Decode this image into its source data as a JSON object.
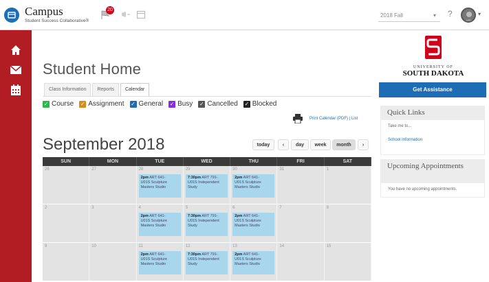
{
  "header": {
    "app_name": "Campus",
    "app_subtitle": "Student Success Collaborative®",
    "notification_count": "20",
    "term": "2018 Fall",
    "help": "?"
  },
  "page": {
    "title": "Student Home",
    "tabs": [
      {
        "label": "Class Information",
        "active": false
      },
      {
        "label": "Reports",
        "active": false
      },
      {
        "label": "Calendar",
        "active": true
      }
    ],
    "legend": [
      {
        "label": "Course",
        "color": "#2eb84b"
      },
      {
        "label": "Assignment",
        "color": "#d98b1a"
      },
      {
        "label": "General",
        "color": "#1d6cb6"
      },
      {
        "label": "Busy",
        "color": "#8a2be2"
      },
      {
        "label": "Cancelled",
        "color": "#555555"
      },
      {
        "label": "Blocked",
        "color": "#222222"
      }
    ],
    "print_link": "Print Calendar (PDF) | List",
    "month_title": "September 2018",
    "nav": {
      "today": "today",
      "prev": "‹",
      "day": "day",
      "week": "week",
      "month": "month",
      "next": "›"
    }
  },
  "calendar": {
    "weekdays": [
      "SUN",
      "MON",
      "TUE",
      "WED",
      "THU",
      "FRI",
      "SAT"
    ],
    "weeks": [
      {
        "days": [
          "26",
          "27",
          "28",
          "29",
          "30",
          "31",
          "1"
        ]
      },
      {
        "days": [
          "2",
          "3",
          "4",
          "5",
          "6",
          "7",
          "8"
        ]
      },
      {
        "days": [
          "9",
          "10",
          "11",
          "12",
          "13",
          "14",
          "15"
        ]
      }
    ],
    "events": {
      "tue": {
        "time": "2pm",
        "code": "ART 641-",
        "line2": "U01S Sculpture",
        "line3": "Masters Studio"
      },
      "wed": {
        "time": "7:30pm",
        "code": "ART 791-",
        "line2": "U01S Independent",
        "line3": "Study"
      },
      "thu": {
        "time": "2pm",
        "code": "ART 641-",
        "line2": "U01S Sculpture",
        "line3": "Masters Studio"
      }
    }
  },
  "right": {
    "univ_line1": "UNIVERSITY OF",
    "univ_line2": "SOUTH DAKOTA",
    "assist_label": "Get Assistance",
    "quick_links_title": "Quick Links",
    "quick_links_intro": "Take me to...",
    "quick_links_item": "School Information",
    "appointments_title": "Upcoming Appointments",
    "appointments_text": "You have no upcoming appointments."
  },
  "colors": {
    "sidebar": "#b21d24",
    "accent": "#1d6cb6",
    "event": "#a8d6ec"
  }
}
